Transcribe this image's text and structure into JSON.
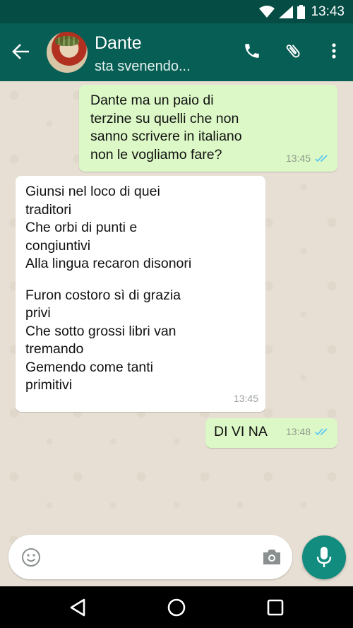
{
  "status_bar": {
    "time": "13:43",
    "icons": [
      "wifi-icon",
      "signal-icon",
      "battery-icon"
    ]
  },
  "header": {
    "contact_name": "Dante",
    "status": "sta svenendo...",
    "icons": [
      "back-arrow-icon",
      "phone-icon",
      "paperclip-icon",
      "more-vert-icon"
    ]
  },
  "messages": [
    {
      "direction": "outgoing",
      "lines": [
        "Dante ma un paio di",
        "terzine su quelli che non",
        "sanno scrivere in italiano",
        "non le vogliamo fare?"
      ],
      "time": "13:45",
      "read": true
    },
    {
      "direction": "incoming",
      "stanza1": [
        "Giunsi nel loco di quei",
        "traditori",
        "Che orbi di punti e",
        "congiuntivi",
        "Alla lingua recaron disonori"
      ],
      "stanza2": [
        "Furon costoro sì di grazia",
        "privi",
        "Che sotto grossi libri van",
        "tremando",
        "Gemendo come tanti",
        "primitivi"
      ],
      "time": "13:45"
    },
    {
      "direction": "outgoing",
      "text": "DI VI NA",
      "time": "13:48",
      "read": true
    }
  ],
  "composer": {
    "placeholder": "",
    "icons": [
      "emoji-icon",
      "camera-icon",
      "mic-icon"
    ]
  },
  "nav": {
    "icons": [
      "nav-back-icon",
      "nav-home-icon",
      "nav-recents-icon"
    ]
  },
  "colors": {
    "header": "#075e54",
    "status_bar": "#054d44",
    "outgoing_bubble": "#dcf8c6",
    "incoming_bubble": "#ffffff",
    "mic": "#128c7e",
    "read_ticks": "#4fc3f7"
  }
}
